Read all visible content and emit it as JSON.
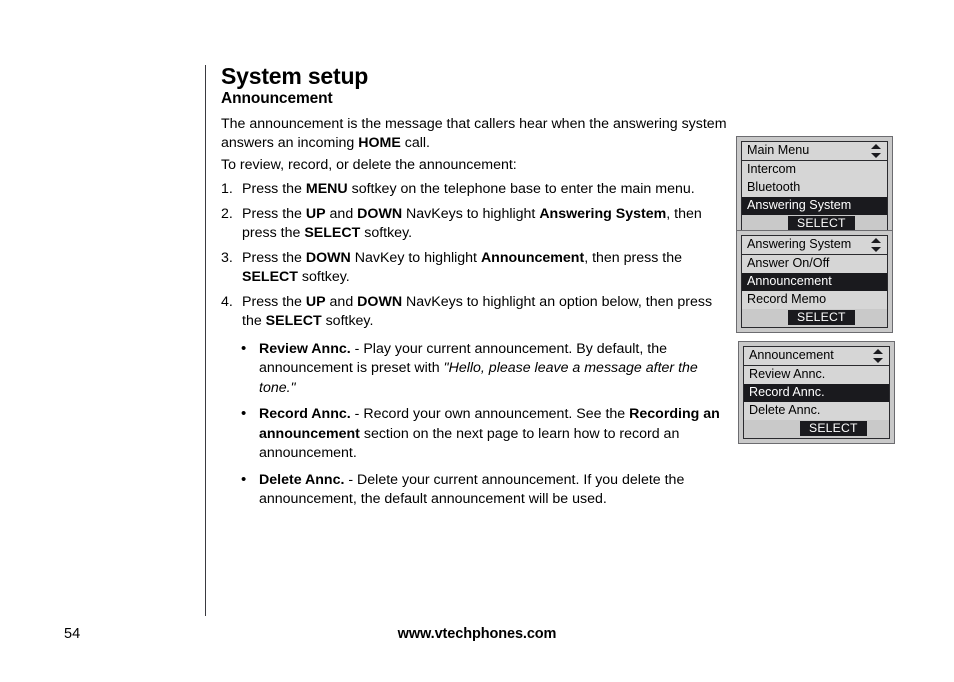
{
  "page": {
    "number": "54",
    "footer_url": "www.vtechphones.com"
  },
  "headings": {
    "title": "System setup",
    "subtitle": "Announcement"
  },
  "intro": {
    "p1_a": "The announcement is the message that callers hear when the answering system answers an incoming ",
    "p1_bold": "HOME",
    "p1_b": " call.",
    "p2": "To review, record, or delete the announcement:"
  },
  "steps": [
    {
      "num": "1.",
      "a": "Press the ",
      "b1": "MENU",
      "b": " softkey on the telephone base to enter the main menu.",
      "b2": "",
      "c": "",
      "b3": "",
      "d": ""
    },
    {
      "num": "2.",
      "a": "Press the ",
      "b1": "UP",
      "b": " and ",
      "b2": "DOWN",
      "c": " NavKeys to highlight ",
      "b3": "Answering System",
      "d": ", then press the ",
      "b4": "SELECT",
      "e": " softkey."
    },
    {
      "num": "3.",
      "a": "Press the ",
      "b1": "DOWN",
      "b": " NavKey to highlight ",
      "b2": "Announcement",
      "c": ", then press the ",
      "b3": "SELECT",
      "d": " softkey."
    },
    {
      "num": "4.",
      "a": "Press the ",
      "b1": "UP",
      "b": " and ",
      "b2": "DOWN",
      "c": " NavKeys to highlight an option below, then press the ",
      "b3": "SELECT",
      "d": " softkey."
    }
  ],
  "options": [
    {
      "bullet": "•",
      "term": "Review Annc.",
      "a": " - Play your current announcement. By default, the announcement is preset with ",
      "quote": "\"Hello, please leave a message after the tone.\"",
      "b": "",
      "term2": "",
      "c": ""
    },
    {
      "bullet": "•",
      "term": "Record Annc.",
      "a": " - Record your own announcement. See the ",
      "quote": "",
      "term2": "Recording an announcement",
      "b": " section on the next page to learn how to record an announcement.",
      "c": ""
    },
    {
      "bullet": "•",
      "term": "Delete Annc.",
      "a": " - Delete your current announcement. If you delete the announcement, the default announcement will be used.",
      "quote": "",
      "term2": "",
      "b": "",
      "c": ""
    }
  ],
  "lcd_screens": [
    {
      "title": "Main Menu",
      "scroll_icon": "up-down-arrow-icon",
      "rows": [
        {
          "label": "Intercom",
          "selected": false
        },
        {
          "label": "Bluetooth",
          "selected": false
        },
        {
          "label": "Answering System",
          "selected": true
        }
      ],
      "softkey": "SELECT",
      "softkey_offset": "46px"
    },
    {
      "title": "Answering System",
      "scroll_icon": "up-down-arrow-icon",
      "rows": [
        {
          "label": "Answer On/Off",
          "selected": false
        },
        {
          "label": "Announcement",
          "selected": true
        },
        {
          "label": "Record Memo",
          "selected": false
        }
      ],
      "softkey": "SELECT",
      "softkey_offset": "46px"
    },
    {
      "title": "Announcement",
      "scroll_icon": "up-down-arrow-icon",
      "rows": [
        {
          "label": "Review Annc.",
          "selected": false
        },
        {
          "label": "Record Annc.",
          "selected": true
        },
        {
          "label": "Delete Annc.",
          "selected": false
        }
      ],
      "softkey": "SELECT",
      "softkey_offset": "56px"
    }
  ],
  "colors": {
    "lcd_frame": "#c9c9c9",
    "lcd_border": "#6c6c70",
    "lcd_screen": "#d6d6d6",
    "lcd_highlight": "#1a1a1e",
    "rule": "#3a3a40"
  }
}
